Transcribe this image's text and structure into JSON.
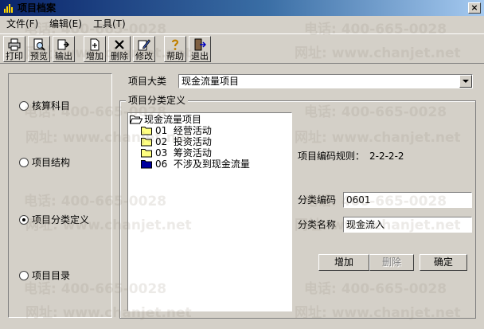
{
  "window": {
    "title": "项目档案"
  },
  "menu": [
    "文件(F)",
    "编辑(E)",
    "工具(T)"
  ],
  "toolbar": [
    "打印",
    "预览",
    "输出",
    "增加",
    "删除",
    "修改",
    "帮助",
    "退出"
  ],
  "left_options": [
    {
      "label": "核算科目",
      "checked": false
    },
    {
      "label": "项目结构",
      "checked": false
    },
    {
      "label": "项目分类定义",
      "checked": true
    },
    {
      "label": "项目目录",
      "checked": false
    }
  ],
  "category": {
    "label": "项目大类",
    "value": "现金流量项目"
  },
  "group": {
    "title": "项目分类定义"
  },
  "tree": {
    "root": "现金流量项目",
    "items": [
      {
        "code": "01",
        "name": "经营活动"
      },
      {
        "code": "02",
        "name": "投资活动"
      },
      {
        "code": "03",
        "name": "筹资活动"
      },
      {
        "code": "06",
        "name": "不涉及到现金流量"
      }
    ]
  },
  "rule": {
    "label": "项目编码规则：",
    "value": "2-2-2-2"
  },
  "form": {
    "code_label": "分类编码",
    "code_value": "0601",
    "name_label": "分类名称",
    "name_value": "现金流入"
  },
  "buttons": {
    "add": "增加",
    "delete": "删除",
    "confirm": "确定"
  },
  "watermark": {
    "phone": "电话: 400-665-0028",
    "site": "网址: www.chanjet.net"
  },
  "colors": {
    "title_start": "#0a246a",
    "title_end": "#a6caf0",
    "face": "#d4d0c8"
  }
}
